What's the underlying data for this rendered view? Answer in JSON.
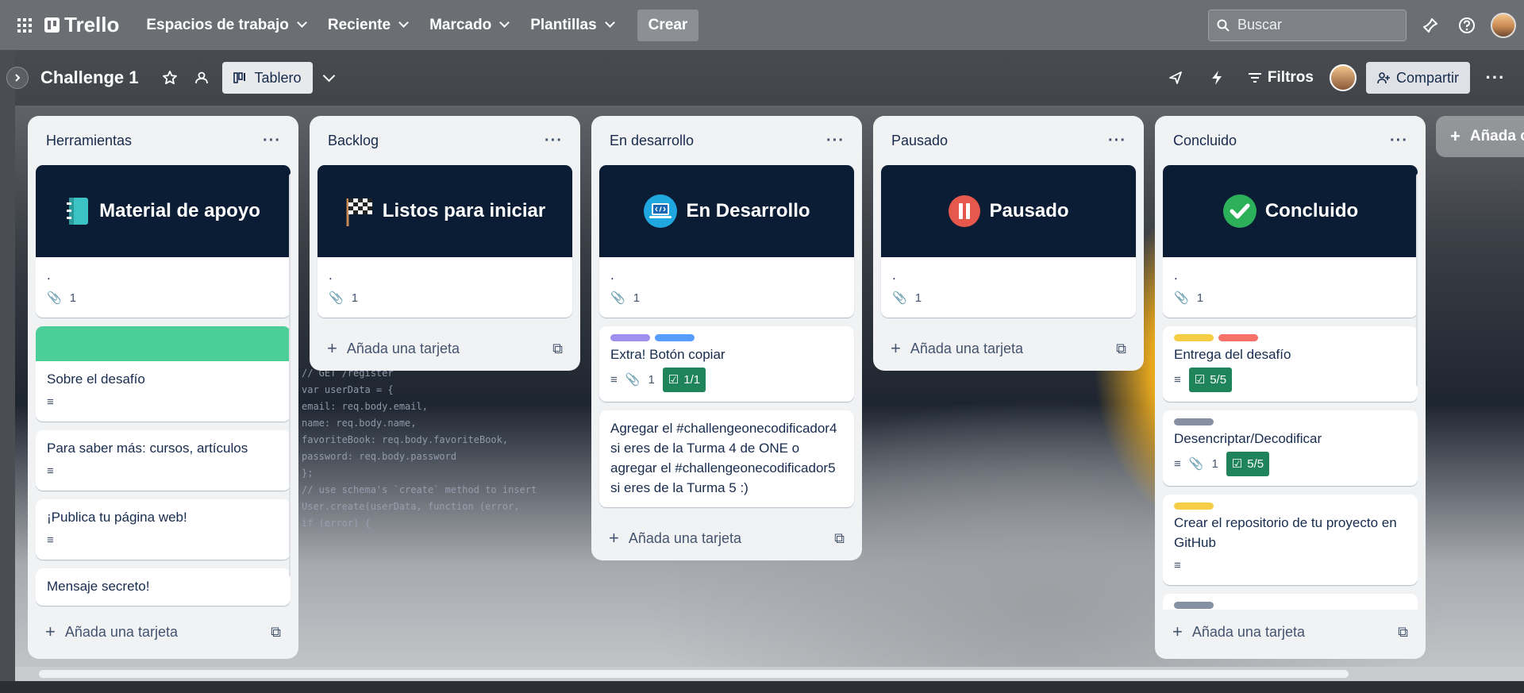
{
  "nav": {
    "logo": "Trello",
    "menus": [
      {
        "label": "Espacios de trabajo"
      },
      {
        "label": "Reciente"
      },
      {
        "label": "Marcado"
      },
      {
        "label": "Plantillas"
      }
    ],
    "create": "Crear",
    "search_placeholder": "Buscar"
  },
  "board": {
    "title": "Challenge 1",
    "view": "Tablero",
    "filters": "Filtros",
    "share": "Compartir",
    "add_list": "Añada otra lista"
  },
  "lists": [
    {
      "title": "Herramientas",
      "add_card": "Añada una tarjeta",
      "cards": [
        {
          "cover_title": "Material de apoyo",
          "cover_icon": "notebook-emoji",
          "text": ".",
          "attachments": "1"
        },
        {
          "cover_color": "#4bce97",
          "text": "Sobre el desafío",
          "description": true
        },
        {
          "text": "Para saber más: cursos, artículos",
          "description": true
        },
        {
          "text": "¡Publica tu página web!",
          "description": true
        },
        {
          "text": "Mensaje secreto!"
        }
      ]
    },
    {
      "title": "Backlog",
      "add_card": "Añada una tarjeta",
      "cards": [
        {
          "cover_title": "Listos para iniciar",
          "cover_icon": "checkered-flag-emoji",
          "text": ".",
          "attachments": "1"
        }
      ]
    },
    {
      "title": "En desarrollo",
      "add_card": "Añada una tarjeta",
      "cards": [
        {
          "cover_title": "En Desarrollo",
          "cover_icon": "laptop-code-icon",
          "text": ".",
          "attachments": "1"
        },
        {
          "labels": [
            "#9f8fef",
            "#579dff"
          ],
          "text": "Extra! Botón copiar",
          "description": true,
          "attachments": "1",
          "checklist": "1/1"
        },
        {
          "text": "Agregar el #challengeonecodificador4 si eres de la Turma 4 de ONE o agregar el #challengeonecodificador5 si eres de la Turma 5 :)"
        }
      ]
    },
    {
      "title": "Pausado",
      "add_card": "Añada una tarjeta",
      "cards": [
        {
          "cover_title": "Pausado",
          "cover_icon": "pause-icon",
          "text": ".",
          "attachments": "1"
        }
      ]
    },
    {
      "title": "Concluido",
      "add_card": "Añada una tarjeta",
      "cards": [
        {
          "cover_title": "Concluido",
          "cover_icon": "check-mark-icon",
          "text": ".",
          "attachments": "1"
        },
        {
          "labels": [
            "#f5cd47",
            "#f87168"
          ],
          "text": "Entrega del desafío",
          "description": true,
          "checklist": "5/5"
        },
        {
          "labels": [
            "#8590a2"
          ],
          "text": "Desencriptar/Decodificar",
          "description": true,
          "attachments": "1",
          "checklist": "5/5"
        },
        {
          "labels": [
            "#f5cd47"
          ],
          "text": "Crear el repositorio de tu proyecto en GitHub",
          "description": true
        }
      ]
    }
  ],
  "background_code": [
    "// GET /register",
    "var userData = {",
    "  email: req.body.email,",
    "  name: req.body.name,",
    "  favoriteBook: req.body.favoriteBook,",
    "  password: req.body.password",
    "};",
    "// use schema's `create` method to insert",
    "User.create(userData, function (error,",
    "  if (error) {"
  ],
  "colors": {
    "nav_bg": "#6b6e73",
    "cover_bg": "#0b1d34",
    "checklist_done": "#1f845a"
  }
}
